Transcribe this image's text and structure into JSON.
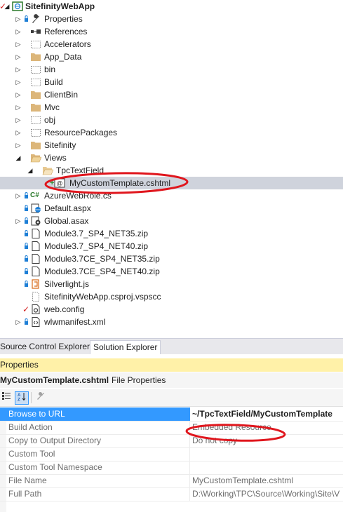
{
  "solution_tree": {
    "items": [
      {
        "label": "SitefinityWebApp",
        "icon": "web-project-icon",
        "expander": "expanded"
      },
      {
        "label": "Properties",
        "icon": "wrench-icon",
        "expander": "collapsed"
      },
      {
        "label": "References",
        "icon": "references-icon",
        "expander": "collapsed"
      },
      {
        "label": "Accelerators",
        "icon": "dotted-folder-icon",
        "expander": "collapsed"
      },
      {
        "label": "App_Data",
        "icon": "folder-icon",
        "expander": "collapsed"
      },
      {
        "label": "bin",
        "icon": "dotted-folder-icon",
        "expander": "collapsed"
      },
      {
        "label": "Build",
        "icon": "dotted-folder-icon",
        "expander": "collapsed"
      },
      {
        "label": "ClientBin",
        "icon": "folder-icon",
        "expander": "collapsed"
      },
      {
        "label": "Mvc",
        "icon": "folder-icon",
        "expander": "collapsed"
      },
      {
        "label": "obj",
        "icon": "dotted-folder-icon",
        "expander": "collapsed"
      },
      {
        "label": "ResourcePackages",
        "icon": "dotted-folder-icon",
        "expander": "collapsed"
      },
      {
        "label": "Sitefinity",
        "icon": "folder-icon",
        "expander": "collapsed"
      },
      {
        "label": "Views",
        "icon": "open-folder-icon",
        "expander": "expanded"
      },
      {
        "label": "TpcTextField",
        "icon": "open-folder-icon",
        "expander": "expanded"
      },
      {
        "label": "MyCustomTemplate.cshtml",
        "icon": "razor-file-icon",
        "expander": "none"
      },
      {
        "label": "AzureWebRole.cs",
        "icon": "csharp-file-icon",
        "expander": "collapsed"
      },
      {
        "label": "Default.aspx",
        "icon": "aspx-file-icon",
        "expander": "none"
      },
      {
        "label": "Global.asax",
        "icon": "asax-file-icon",
        "expander": "collapsed"
      },
      {
        "label": "Module3.7_SP4_NET35.zip",
        "icon": "file-icon",
        "expander": "none"
      },
      {
        "label": "Module3.7_SP4_NET40.zip",
        "icon": "file-icon",
        "expander": "none"
      },
      {
        "label": "Module3.7CE_SP4_NET35.zip",
        "icon": "file-icon",
        "expander": "none"
      },
      {
        "label": "Module3.7CE_SP4_NET40.zip",
        "icon": "file-icon",
        "expander": "none"
      },
      {
        "label": "Silverlight.js",
        "icon": "js-file-icon",
        "expander": "none"
      },
      {
        "label": "SitefinityWebApp.csproj.vspscc",
        "icon": "dotted-file-icon",
        "expander": "none"
      },
      {
        "label": "web.config",
        "icon": "config-file-icon",
        "expander": "none"
      },
      {
        "label": "wlwmanifest.xml",
        "icon": "xml-file-icon",
        "expander": "none"
      }
    ]
  },
  "tabs": [
    {
      "label": "Source Control Explorer"
    },
    {
      "label": "Solution Explorer"
    }
  ],
  "properties": {
    "title": "Properties",
    "object_name": "MyCustomTemplate.cshtml",
    "object_type": "File Properties",
    "rows": [
      {
        "name": "Browse to URL",
        "value": "~/TpcTextField/MyCustomTemplate"
      },
      {
        "name": "Build Action",
        "value": "Embedded Resource"
      },
      {
        "name": "Copy to Output Directory",
        "value": "Do not copy"
      },
      {
        "name": "Custom Tool",
        "value": ""
      },
      {
        "name": "Custom Tool Namespace",
        "value": ""
      },
      {
        "name": "File Name",
        "value": "MyCustomTemplate.cshtml"
      },
      {
        "name": "Full Path",
        "value": "D:\\Working\\TPC\\Source\\Working\\Site\\V"
      }
    ]
  },
  "colors": {
    "selection": "#cfd3dc",
    "grid_selection": "#3399ff",
    "properties_header": "#fff1a8",
    "annotation": "#e0161d",
    "lock": "#1e7fd6",
    "checkmark": "#d42020",
    "folder": "#dcb67a"
  }
}
